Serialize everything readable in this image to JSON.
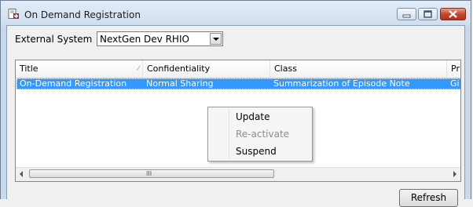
{
  "window": {
    "title": "On Demand Registration"
  },
  "external_system": {
    "label": "External System",
    "selected": "NextGen Dev RHIO"
  },
  "table": {
    "columns": [
      {
        "label": "Title",
        "sort_icon": "⁄"
      },
      {
        "label": "Confidentiality"
      },
      {
        "label": "Class"
      },
      {
        "label": "Pr"
      }
    ],
    "rows": [
      [
        "On-Demand Registration",
        "Normal Sharing",
        "Summarization of Episode Note",
        "Gi"
      ]
    ],
    "scroll_grip": "III"
  },
  "context_menu": {
    "items": [
      {
        "label": "Update",
        "enabled": true
      },
      {
        "label": "Re-activate",
        "enabled": false
      },
      {
        "label": "Suspend",
        "enabled": true
      }
    ]
  },
  "buttons": {
    "refresh": "Refresh"
  }
}
